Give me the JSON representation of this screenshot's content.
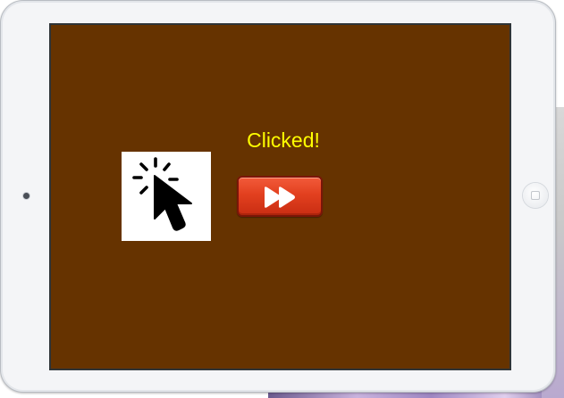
{
  "screen": {
    "status_text": "Clicked!",
    "background_color": "#663300",
    "status_color": "#ffff00"
  },
  "icons": {
    "pointer": "click-cursor-icon",
    "action": "fast-forward-icon"
  },
  "colors": {
    "button_accent": "#e2401f",
    "device_frame": "#f4f5f7"
  }
}
